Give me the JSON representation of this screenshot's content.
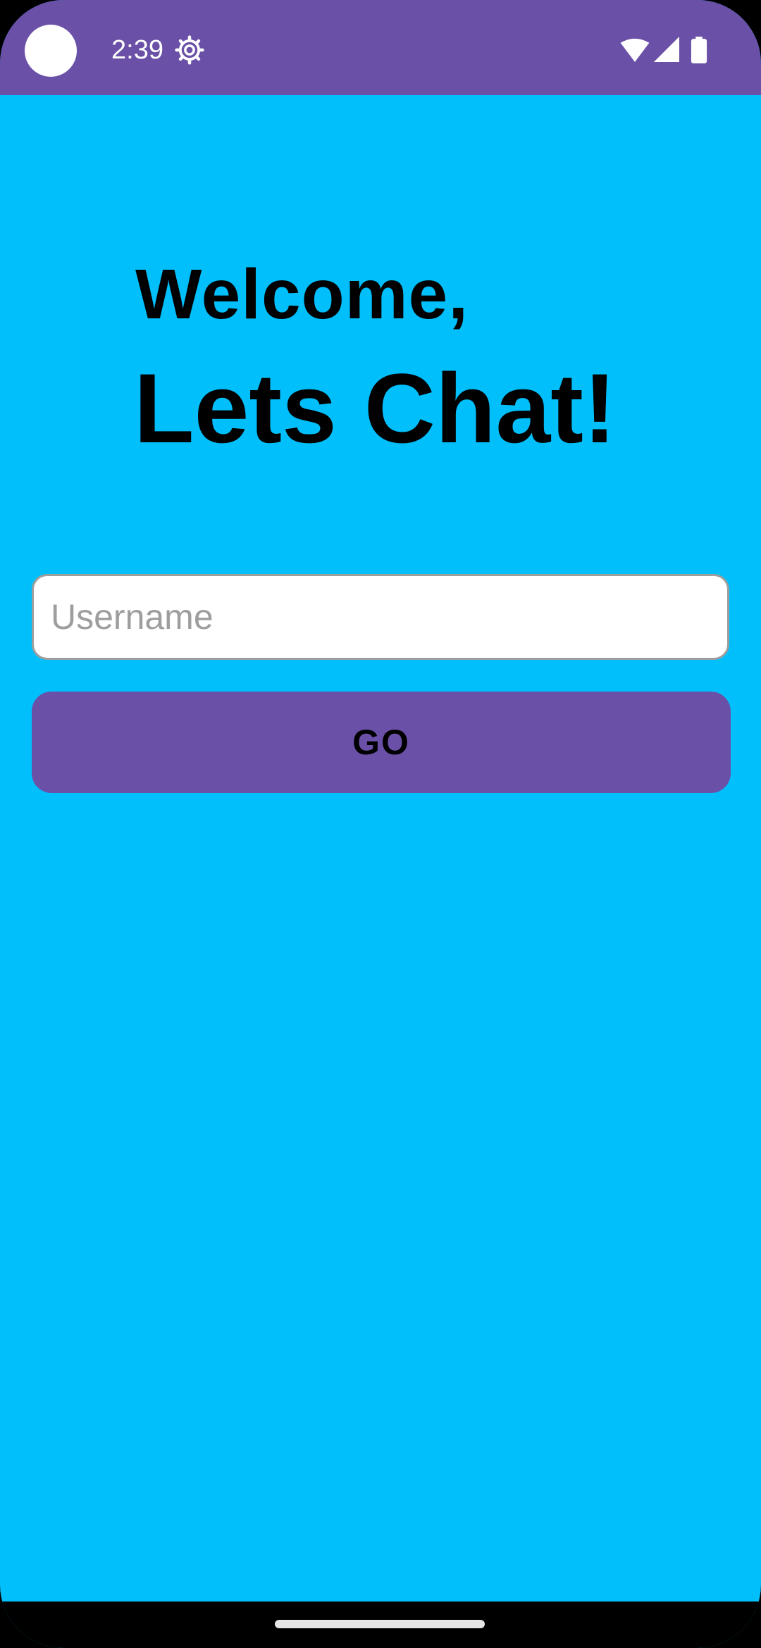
{
  "status_bar": {
    "time": "2:39",
    "background_color": "#6A50A7",
    "icons": [
      "camera-dot",
      "gear-icon",
      "wifi-icon",
      "signal-icon",
      "battery-icon"
    ]
  },
  "main": {
    "background_color": "#00BFFA",
    "welcome_text": "Welcome,",
    "headline": "Lets Chat!",
    "username": {
      "value": "",
      "placeholder": "Username"
    },
    "go_button_label": "GO",
    "accent_color": "#6A50A7"
  },
  "navigation": {
    "home_indicator": "home-indicator"
  }
}
